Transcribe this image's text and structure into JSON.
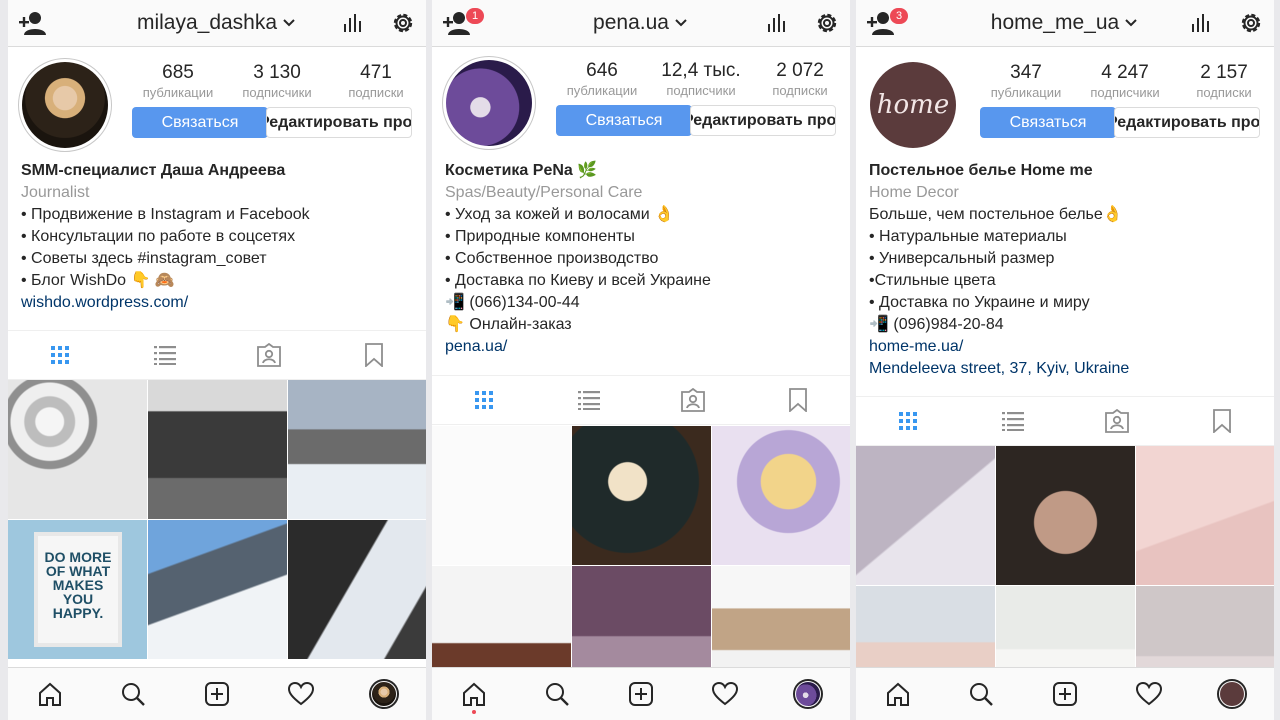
{
  "profiles": [
    {
      "username": "milaya_dashka",
      "badge": "",
      "stats": [
        {
          "value": "685",
          "label": "публикации"
        },
        {
          "value": "3 130",
          "label": "подписчики"
        },
        {
          "value": "471",
          "label": "подписки"
        }
      ],
      "contact_button": "Связаться",
      "edit_button": "Редактировать профиль",
      "bio": {
        "name": "SMM-специалист Даша Андреева",
        "category": "Journalist",
        "lines": [
          "• Продвижение в Instagram и Facebook",
          "• Консультации по работе в соцсетях",
          "• Советы здесь #instagram_совет",
          "• Блог WishDo 👇 🙈"
        ],
        "link": "wishdo.wordpress.com/"
      },
      "poster_text": "DO MORE OF WHAT MAKES YOU HAPPY."
    },
    {
      "username": "pena.ua",
      "badge": "1",
      "stats": [
        {
          "value": "646",
          "label": "публикации"
        },
        {
          "value": "12,4 тыс.",
          "label": "подписчики"
        },
        {
          "value": "2 072",
          "label": "подписки"
        }
      ],
      "contact_button": "Связаться",
      "edit_button": "Редактировать профиль",
      "bio": {
        "name": "Косметика PeNa 🌿",
        "category": "Spas/Beauty/Personal Care",
        "lines": [
          "• Уход за кожей и волосами 👌",
          "• Природные компоненты",
          "• Собственное производство",
          "• Доставка по Киеву и всей Украине",
          "📲 (066)134-00-44",
          "👇 Онлайн-заказ"
        ],
        "link": "pena.ua/"
      }
    },
    {
      "username": "home_me_ua",
      "badge": "3",
      "stats": [
        {
          "value": "347",
          "label": "публикации"
        },
        {
          "value": "4 247",
          "label": "подписчики"
        },
        {
          "value": "2 157",
          "label": "подписки"
        }
      ],
      "contact_button": "Связаться",
      "edit_button": "Редактировать профиль",
      "bio": {
        "name": "Постельное белье Home me",
        "category": "Home Decor",
        "lines": [
          "Больше, чем постельное белье👌",
          "• Натуральные материалы",
          "• Универсальный размер",
          "•Стильные цвета",
          "• Доставка по Украине и миру",
          "📲 (096)984-20-84"
        ],
        "link": "home-me.ua/",
        "address": "Mendeleeva street, 37, Kyiv, Ukraine"
      },
      "logo_text": "home"
    }
  ],
  "colors": {
    "contact_blue": "#5897ee",
    "badge_red": "#ed4956",
    "tab_active": "#3897f0",
    "link_blue": "#003569"
  },
  "icons": [
    "add-user-icon",
    "chevron-down-icon",
    "insights-icon",
    "gear-icon",
    "grid-icon",
    "list-icon",
    "tagged-icon",
    "bookmark-icon",
    "home-icon",
    "search-icon",
    "new-post-icon",
    "heart-icon",
    "profile-avatar-icon"
  ]
}
